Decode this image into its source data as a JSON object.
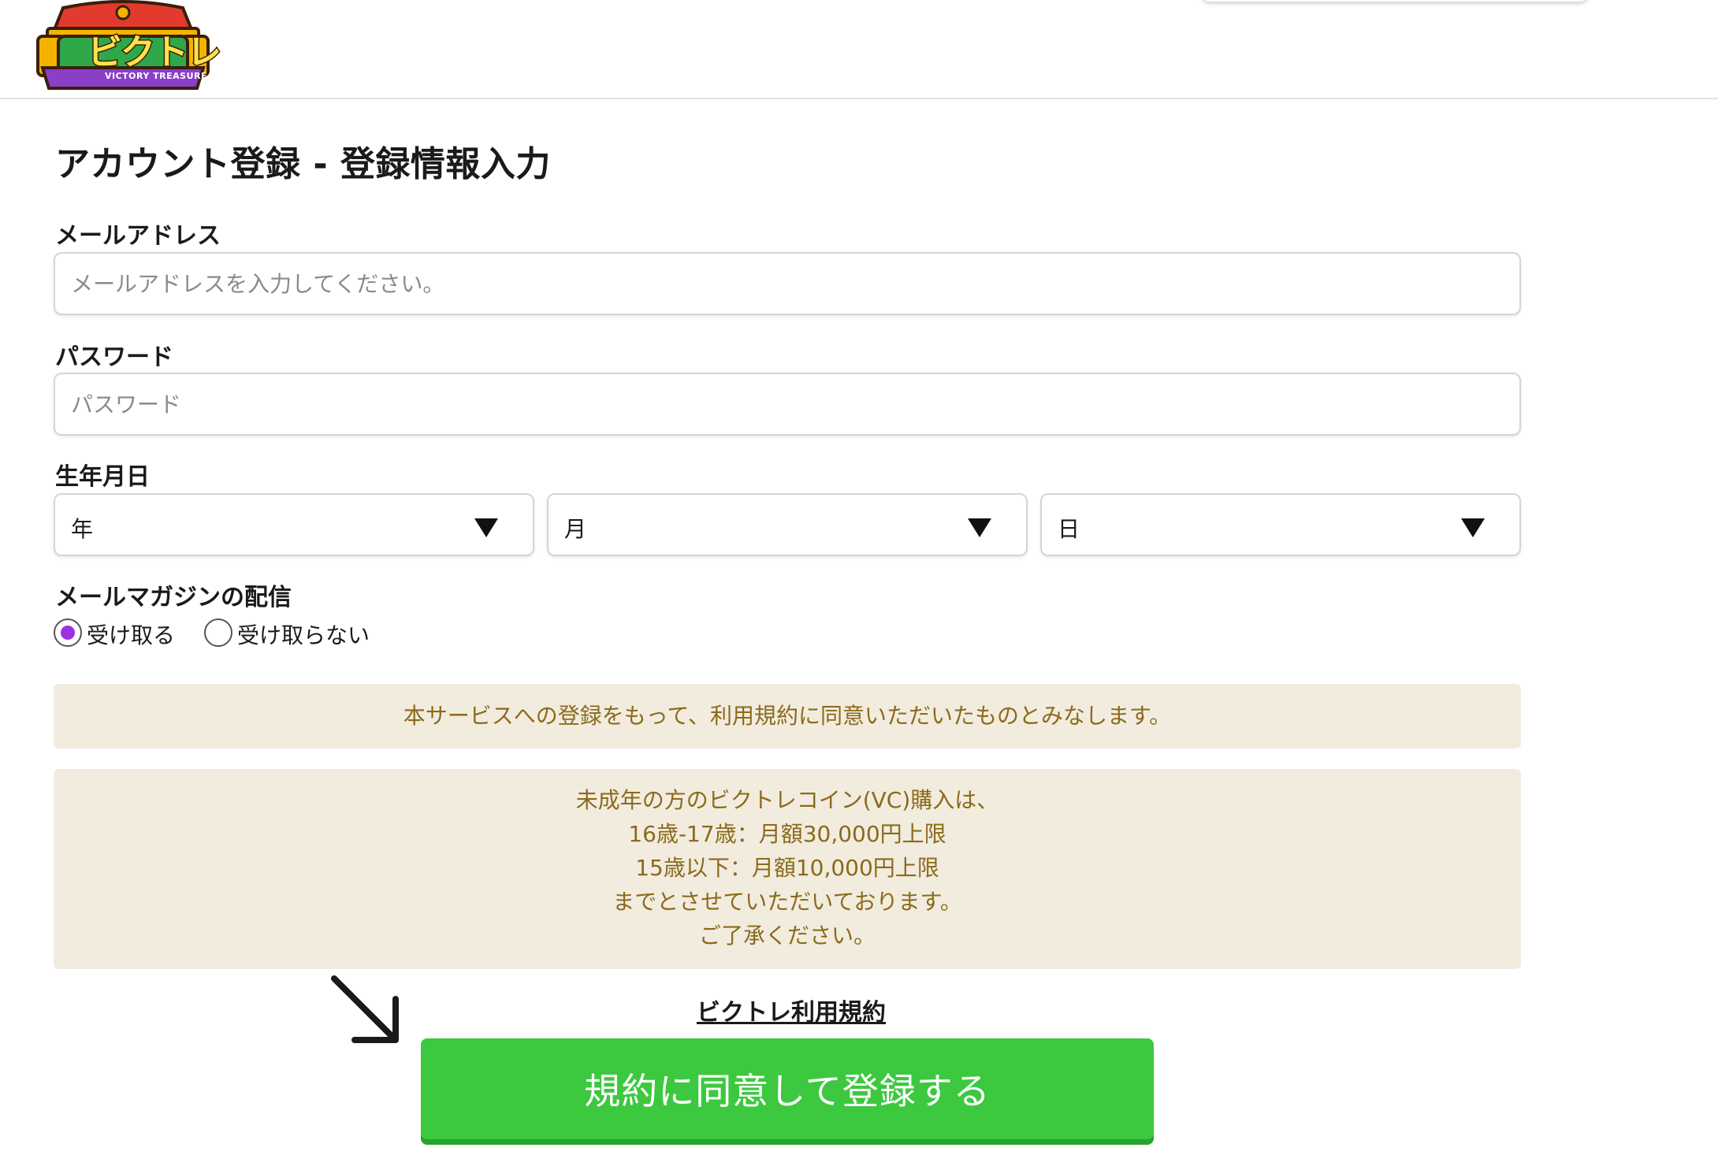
{
  "logo": {
    "word": "ビクトレ",
    "subtext": "VICTORY TREASURE",
    "icon": "victory-treasure-logo"
  },
  "form": {
    "title": "アカウント登録 - 登録情報入力",
    "email": {
      "label": "メールアドレス",
      "placeholder": "メールアドレスを入力してください。",
      "value": ""
    },
    "password": {
      "label": "パスワード",
      "placeholder": "パスワード",
      "value": ""
    },
    "birthday": {
      "label": "生年月日",
      "year": "年",
      "month": "月",
      "day": "日",
      "arrow_icon": "triangle-down-icon"
    },
    "newsletter": {
      "label": "メールマガジンの配信",
      "options": [
        {
          "label": "受け取る",
          "checked": true
        },
        {
          "label": "受け取らない",
          "checked": false
        }
      ]
    }
  },
  "notices": {
    "agreement": "本サービスへの登録をもって、利用規約に同意いただいたものとみなします。",
    "minor_lines": [
      "未成年の方のビクトレコイン(VC)購入は、",
      "16歳-17歳：月額30,000円上限",
      "15歳以下：月額10,000円上限",
      "までとさせていただいております。",
      "ご了承ください。"
    ]
  },
  "terms_link": "ビクトレ利用規約",
  "submit_label": "規約に同意して登録する",
  "annotation_icon": "diagonal-arrow-icon",
  "colors": {
    "submit_green": "#3cc93f",
    "notice_bg": "#f2ecdf",
    "notice_text": "#8b6a1a",
    "radio_accent": "#9b32e0"
  }
}
